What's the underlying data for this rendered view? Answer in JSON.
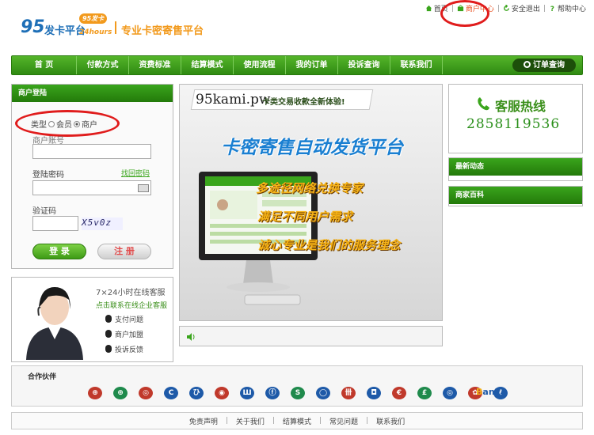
{
  "header": {
    "logo_num": "95",
    "logo_word": "发卡平台",
    "logo_tag": "95发卡",
    "logo_sub": "24hours",
    "slogan": "专业卡密寄售平台",
    "top_links": [
      "首页",
      "商户中心",
      "安全退出",
      "帮助中心"
    ]
  },
  "nav": {
    "items": [
      "首 页",
      "付款方式",
      "资费标准",
      "结算模式",
      "使用流程",
      "我的订单",
      "投诉查询",
      "联系我们"
    ],
    "order_query": "订单查询"
  },
  "login": {
    "title": "商户登陆",
    "type_label": "类型",
    "type_options": [
      "会员",
      "商户"
    ],
    "account_label": "商户账号",
    "password_label": "登陆密码",
    "forgot_link": "找回密码",
    "captcha_label": "验证码",
    "captcha_text": "X5v0z",
    "login_button": "登 录",
    "register_button": "注 册"
  },
  "support": {
    "title": "7×24小时在线客服",
    "contact_link": "点击联系在线企业客服",
    "links": [
      "支付问题",
      "商户加盟",
      "投诉反馈"
    ]
  },
  "banner": {
    "site": "95kami.pw",
    "headline": "卡类交易收款全新体验!",
    "title": "卡密寄售自动发货平台",
    "slogans": [
      "多途径网络兑换专家",
      "满足不同用户需求",
      "诚心专业是我们的服务理念"
    ]
  },
  "hotline": {
    "title": "客服热线",
    "number": "2858119536"
  },
  "news": {
    "title": "最新动态"
  },
  "encyclopedia": {
    "title": "商家百科"
  },
  "partners": {
    "title": "合作伙伴",
    "logos": [
      {
        "glyph": "⊕",
        "color": "#c0392b"
      },
      {
        "glyph": "⊕",
        "color": "#1f8a4c"
      },
      {
        "glyph": "◎",
        "color": "#c0392b"
      },
      {
        "glyph": "C",
        "color": "#1e5aa8"
      },
      {
        "glyph": "ひ",
        "color": "#1e5aa8"
      },
      {
        "glyph": "◉",
        "color": "#c0392b"
      },
      {
        "glyph": "Ш",
        "color": "#1e5aa8"
      },
      {
        "glyph": "ⓕ",
        "color": "#1e5aa8"
      },
      {
        "glyph": "S",
        "color": "#1f8a4c"
      },
      {
        "glyph": "◯",
        "color": "#1e5aa8"
      },
      {
        "glyph": "卌",
        "color": "#c0392b"
      },
      {
        "glyph": "◘",
        "color": "#1e5aa8"
      },
      {
        "glyph": "€",
        "color": "#c0392b"
      },
      {
        "glyph": "£",
        "color": "#1f8a4c"
      },
      {
        "glyph": "◎",
        "color": "#1e5aa8"
      },
      {
        "glyph": "✿",
        "color": "#c0392b"
      },
      {
        "glyph": "ℓ",
        "color": "#1e5aa8"
      }
    ],
    "last_logo_prefix": "B",
    "last_logo_suffix": "ank"
  },
  "footer": {
    "links": [
      "免责声明",
      "关于我们",
      "结算模式",
      "常见问题",
      "联系我们"
    ]
  },
  "colors": {
    "brand_green": "#3aa51c",
    "brand_orange": "#f29a1d",
    "brand_blue": "#1e6fb7",
    "highlight_red": "#e01c1c"
  }
}
